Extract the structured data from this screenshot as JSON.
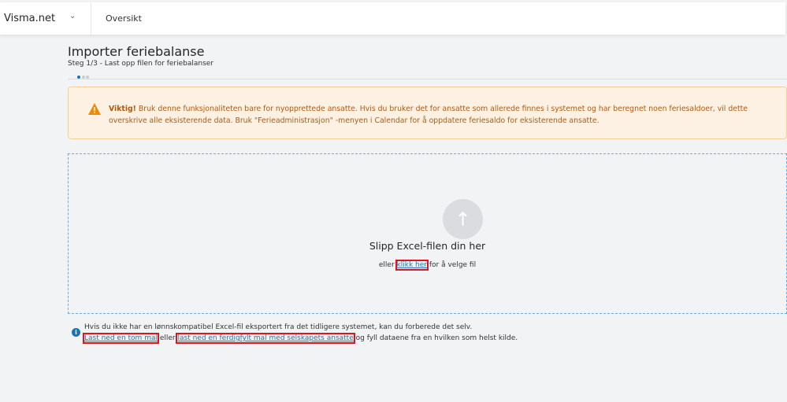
{
  "topbar": {
    "brand": "Visma.net",
    "nav": "Oversikt"
  },
  "page": {
    "title": "Importer feriebalanse",
    "step": "Steg 1/3 - Last opp filen for feriebalanser"
  },
  "alert": {
    "strong": "Viktig!",
    "text": " Bruk denne funksjonaliteten bare for nyopprettede ansatte. Hvis du bruker det for ansatte som allerede finnes i systemet og har beregnet noen feriesaldoer, vil dette overskrive alle eksisterende data. Bruk \"Ferieadministrasjon\" -menyen i Calendar for å oppdatere feriesaldo for eksisterende ansatte."
  },
  "drop": {
    "title": "Slipp Excel-filen din her",
    "prefix": "eller ",
    "link": "klikk her",
    "suffix": " for å velge fil"
  },
  "info": {
    "line1": "Hvis du ikke har en lønnskompatibel Excel-fil eksportert fra det tidligere systemet, kan du forberede det selv.",
    "link1": "Last ned en tom mal",
    "mid": " eller ",
    "link2": "last ned en ferdigfylt mal med selskapets ansatte",
    "end": " og fyll dataene fra en hvilken som helst kilde."
  }
}
